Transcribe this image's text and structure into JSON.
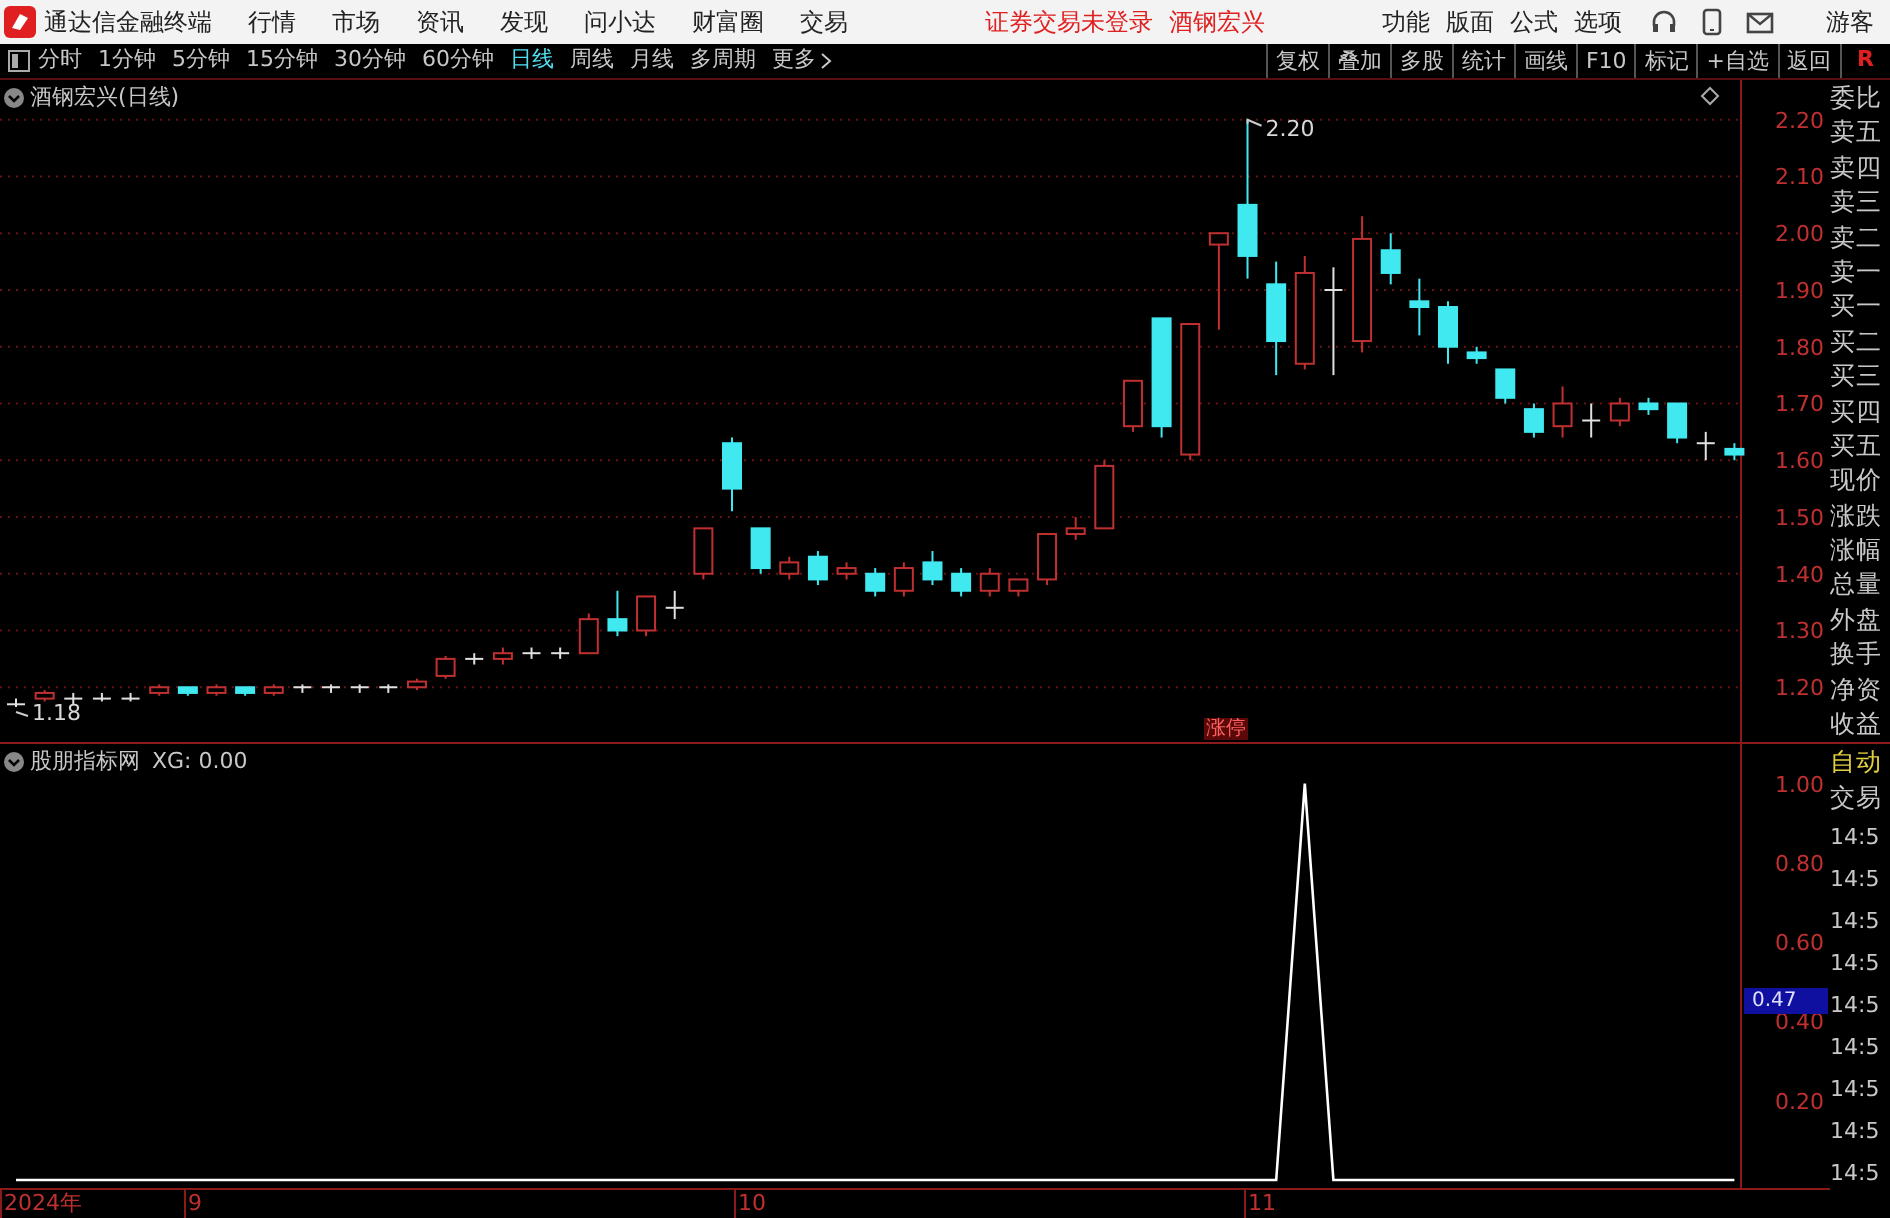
{
  "app_bar": {
    "title": "通达信金融终端",
    "menus": [
      "行情",
      "市场",
      "资讯",
      "发现",
      "问小达",
      "财富圈",
      "交易"
    ],
    "notices": [
      "证券交易未登录",
      "酒钢宏兴"
    ],
    "right_menus": [
      "功能",
      "版面",
      "公式",
      "选项"
    ],
    "user": "游客"
  },
  "toolbar": {
    "periods": [
      {
        "label": "分时",
        "selected": false
      },
      {
        "label": "1分钟",
        "selected": false
      },
      {
        "label": "5分钟",
        "selected": false
      },
      {
        "label": "15分钟",
        "selected": false
      },
      {
        "label": "30分钟",
        "selected": false
      },
      {
        "label": "60分钟",
        "selected": false
      },
      {
        "label": "日线",
        "selected": true
      },
      {
        "label": "周线",
        "selected": false
      },
      {
        "label": "月线",
        "selected": false
      },
      {
        "label": "多周期",
        "selected": false
      }
    ],
    "more": "更多",
    "buttons": [
      "复权",
      "叠加",
      "多股",
      "统计",
      "画线",
      "F10",
      "标记",
      "+自选",
      "返回"
    ],
    "corner": "R"
  },
  "price_chart": {
    "title": "酒钢宏兴(日线)",
    "high_label": "2.20",
    "low_label": "1.18",
    "limit_badge": "涨停",
    "chart_data": {
      "type": "candlestick",
      "grid": true,
      "ylim": [
        1.1,
        2.27
      ],
      "yticks": [
        {
          "value": 2.2,
          "label": "2.20"
        },
        {
          "value": 2.1,
          "label": "2.10"
        },
        {
          "value": 2.0,
          "label": "2.00"
        },
        {
          "value": 1.9,
          "label": "1.90"
        },
        {
          "value": 1.8,
          "label": "1.80"
        },
        {
          "value": 1.7,
          "label": "1.70"
        },
        {
          "value": 1.6,
          "label": "1.60"
        },
        {
          "value": 1.5,
          "label": "1.50"
        },
        {
          "value": 1.4,
          "label": "1.40"
        },
        {
          "value": 1.3,
          "label": "1.30"
        },
        {
          "value": 1.2,
          "label": "1.20"
        }
      ],
      "ohlc": [
        [
          1.17,
          1.18,
          1.165,
          1.17
        ],
        [
          1.18,
          1.195,
          1.175,
          1.19
        ],
        [
          1.18,
          1.19,
          1.17,
          1.18
        ],
        [
          1.18,
          1.19,
          1.175,
          1.18
        ],
        [
          1.18,
          1.19,
          1.175,
          1.18
        ],
        [
          1.19,
          1.205,
          1.185,
          1.2
        ],
        [
          1.2,
          1.2,
          1.185,
          1.19
        ],
        [
          1.19,
          1.205,
          1.185,
          1.2
        ],
        [
          1.2,
          1.2,
          1.185,
          1.19
        ],
        [
          1.19,
          1.205,
          1.185,
          1.2
        ],
        [
          1.2,
          1.205,
          1.19,
          1.2
        ],
        [
          1.2,
          1.205,
          1.19,
          1.2
        ],
        [
          1.2,
          1.205,
          1.19,
          1.2
        ],
        [
          1.2,
          1.205,
          1.19,
          1.2
        ],
        [
          1.2,
          1.215,
          1.195,
          1.21
        ],
        [
          1.22,
          1.255,
          1.215,
          1.25
        ],
        [
          1.25,
          1.26,
          1.24,
          1.25
        ],
        [
          1.25,
          1.27,
          1.24,
          1.26
        ],
        [
          1.26,
          1.27,
          1.25,
          1.26
        ],
        [
          1.26,
          1.27,
          1.25,
          1.26
        ],
        [
          1.26,
          1.33,
          1.26,
          1.32
        ],
        [
          1.32,
          1.37,
          1.29,
          1.3
        ],
        [
          1.3,
          1.36,
          1.29,
          1.36
        ],
        [
          1.34,
          1.37,
          1.32,
          1.34
        ],
        [
          1.4,
          1.48,
          1.39,
          1.48
        ],
        [
          1.63,
          1.64,
          1.51,
          1.55
        ],
        [
          1.48,
          1.48,
          1.4,
          1.41
        ],
        [
          1.4,
          1.43,
          1.39,
          1.42
        ],
        [
          1.43,
          1.44,
          1.38,
          1.39
        ],
        [
          1.4,
          1.42,
          1.39,
          1.41
        ],
        [
          1.4,
          1.41,
          1.36,
          1.37
        ],
        [
          1.37,
          1.42,
          1.36,
          1.41
        ],
        [
          1.42,
          1.44,
          1.38,
          1.39
        ],
        [
          1.4,
          1.41,
          1.36,
          1.37
        ],
        [
          1.37,
          1.41,
          1.36,
          1.4
        ],
        [
          1.37,
          1.39,
          1.36,
          1.39
        ],
        [
          1.39,
          1.47,
          1.38,
          1.47
        ],
        [
          1.47,
          1.5,
          1.46,
          1.48
        ],
        [
          1.48,
          1.6,
          1.48,
          1.59
        ],
        [
          1.66,
          1.74,
          1.65,
          1.74
        ],
        [
          1.85,
          1.85,
          1.64,
          1.66
        ],
        [
          1.61,
          1.84,
          1.6,
          1.84
        ],
        [
          1.98,
          2.0,
          1.83,
          2.0
        ],
        [
          2.05,
          2.2,
          1.92,
          1.96
        ],
        [
          1.91,
          1.95,
          1.75,
          1.81
        ],
        [
          1.77,
          1.96,
          1.76,
          1.93
        ],
        [
          1.9,
          1.94,
          1.75,
          1.9
        ],
        [
          1.81,
          2.03,
          1.79,
          1.99
        ],
        [
          1.97,
          2.0,
          1.91,
          1.93
        ],
        [
          1.88,
          1.92,
          1.82,
          1.87
        ],
        [
          1.87,
          1.88,
          1.77,
          1.8
        ],
        [
          1.79,
          1.8,
          1.77,
          1.78
        ],
        [
          1.76,
          1.76,
          1.7,
          1.71
        ],
        [
          1.69,
          1.7,
          1.64,
          1.65
        ],
        [
          1.66,
          1.73,
          1.64,
          1.7
        ],
        [
          1.67,
          1.7,
          1.64,
          1.67
        ],
        [
          1.67,
          1.71,
          1.66,
          1.7
        ],
        [
          1.7,
          1.71,
          1.68,
          1.69
        ],
        [
          1.7,
          1.7,
          1.63,
          1.64
        ],
        [
          1.63,
          1.65,
          1.6,
          1.63
        ],
        [
          1.62,
          1.63,
          1.6,
          1.61
        ]
      ]
    }
  },
  "indicator": {
    "name": "股朋指标网",
    "reading": "XG: 0.00",
    "cursor_label": "0.47",
    "chart_data": {
      "type": "line",
      "ylim": [
        0,
        1.1
      ],
      "yticks": [
        {
          "value": 1,
          "label": "1.00"
        },
        {
          "value": 0.8,
          "label": "0.80"
        },
        {
          "value": 0.6,
          "label": "0.60"
        },
        {
          "value": 0.4,
          "label": "0.40"
        },
        {
          "value": 0.2,
          "label": "0.20"
        }
      ],
      "series": [
        {
          "color": "#ffffff",
          "values": [
            0,
            0,
            0,
            0,
            0,
            0,
            0,
            0,
            0,
            0,
            0,
            0,
            0,
            0,
            0,
            0,
            0,
            0,
            0,
            0,
            0,
            0,
            0,
            0,
            0,
            0,
            0,
            0,
            0,
            0,
            0,
            0,
            0,
            0,
            0,
            0,
            0,
            0,
            0,
            0,
            0,
            0,
            0,
            0,
            0,
            1,
            0,
            0,
            0,
            0,
            0,
            0,
            0,
            0,
            0,
            0,
            0,
            0,
            0,
            0,
            0
          ]
        }
      ]
    }
  },
  "time_axis": [
    "2024年",
    "9",
    "10",
    "11"
  ],
  "quote_panel": {
    "labels": [
      "委比",
      "卖五",
      "卖四",
      "卖三",
      "卖二",
      "卖一",
      "买一",
      "买二",
      "买三",
      "买四",
      "买五",
      "现价",
      "涨跌",
      "涨幅",
      "总量",
      "外盘",
      "换手",
      "净资",
      "收益"
    ],
    "mode": "自动",
    "trade_header": "交易",
    "times": [
      "14:5",
      "14:5",
      "14:5",
      "14:5",
      "14:5",
      "14:5",
      "14:5",
      "14:5",
      "14:5"
    ]
  }
}
